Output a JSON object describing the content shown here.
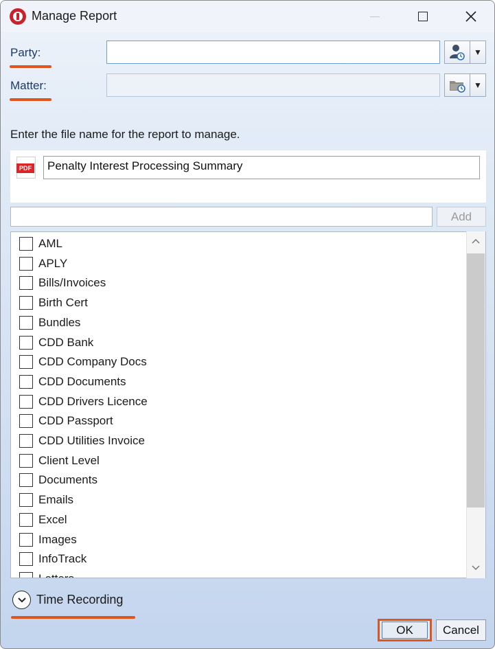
{
  "window": {
    "title": "Manage Report"
  },
  "party": {
    "label": "Party:",
    "value": ""
  },
  "matter": {
    "label": "Matter:",
    "value": ""
  },
  "instruction": "Enter the file name for the report to manage.",
  "file": {
    "icon_text": "PDF",
    "name": "Penalty Interest Processing Summary"
  },
  "new_category": {
    "value": "",
    "add_label": "Add"
  },
  "categories": [
    "AML",
    "APLY",
    "Bills/Invoices",
    "Birth Cert",
    "Bundles",
    "CDD Bank",
    "CDD Company Docs",
    "CDD Documents",
    "CDD Drivers Licence",
    "CDD Passport",
    "CDD Utilities Invoice",
    "Client Level",
    "Documents",
    "Emails",
    "Excel",
    "Images",
    "InfoTrack",
    "Letters"
  ],
  "time_recording": {
    "label": "Time Recording"
  },
  "buttons": {
    "ok": "OK",
    "cancel": "Cancel"
  },
  "colors": {
    "highlight": "#e0541f",
    "label_text": "#1b3b66"
  }
}
